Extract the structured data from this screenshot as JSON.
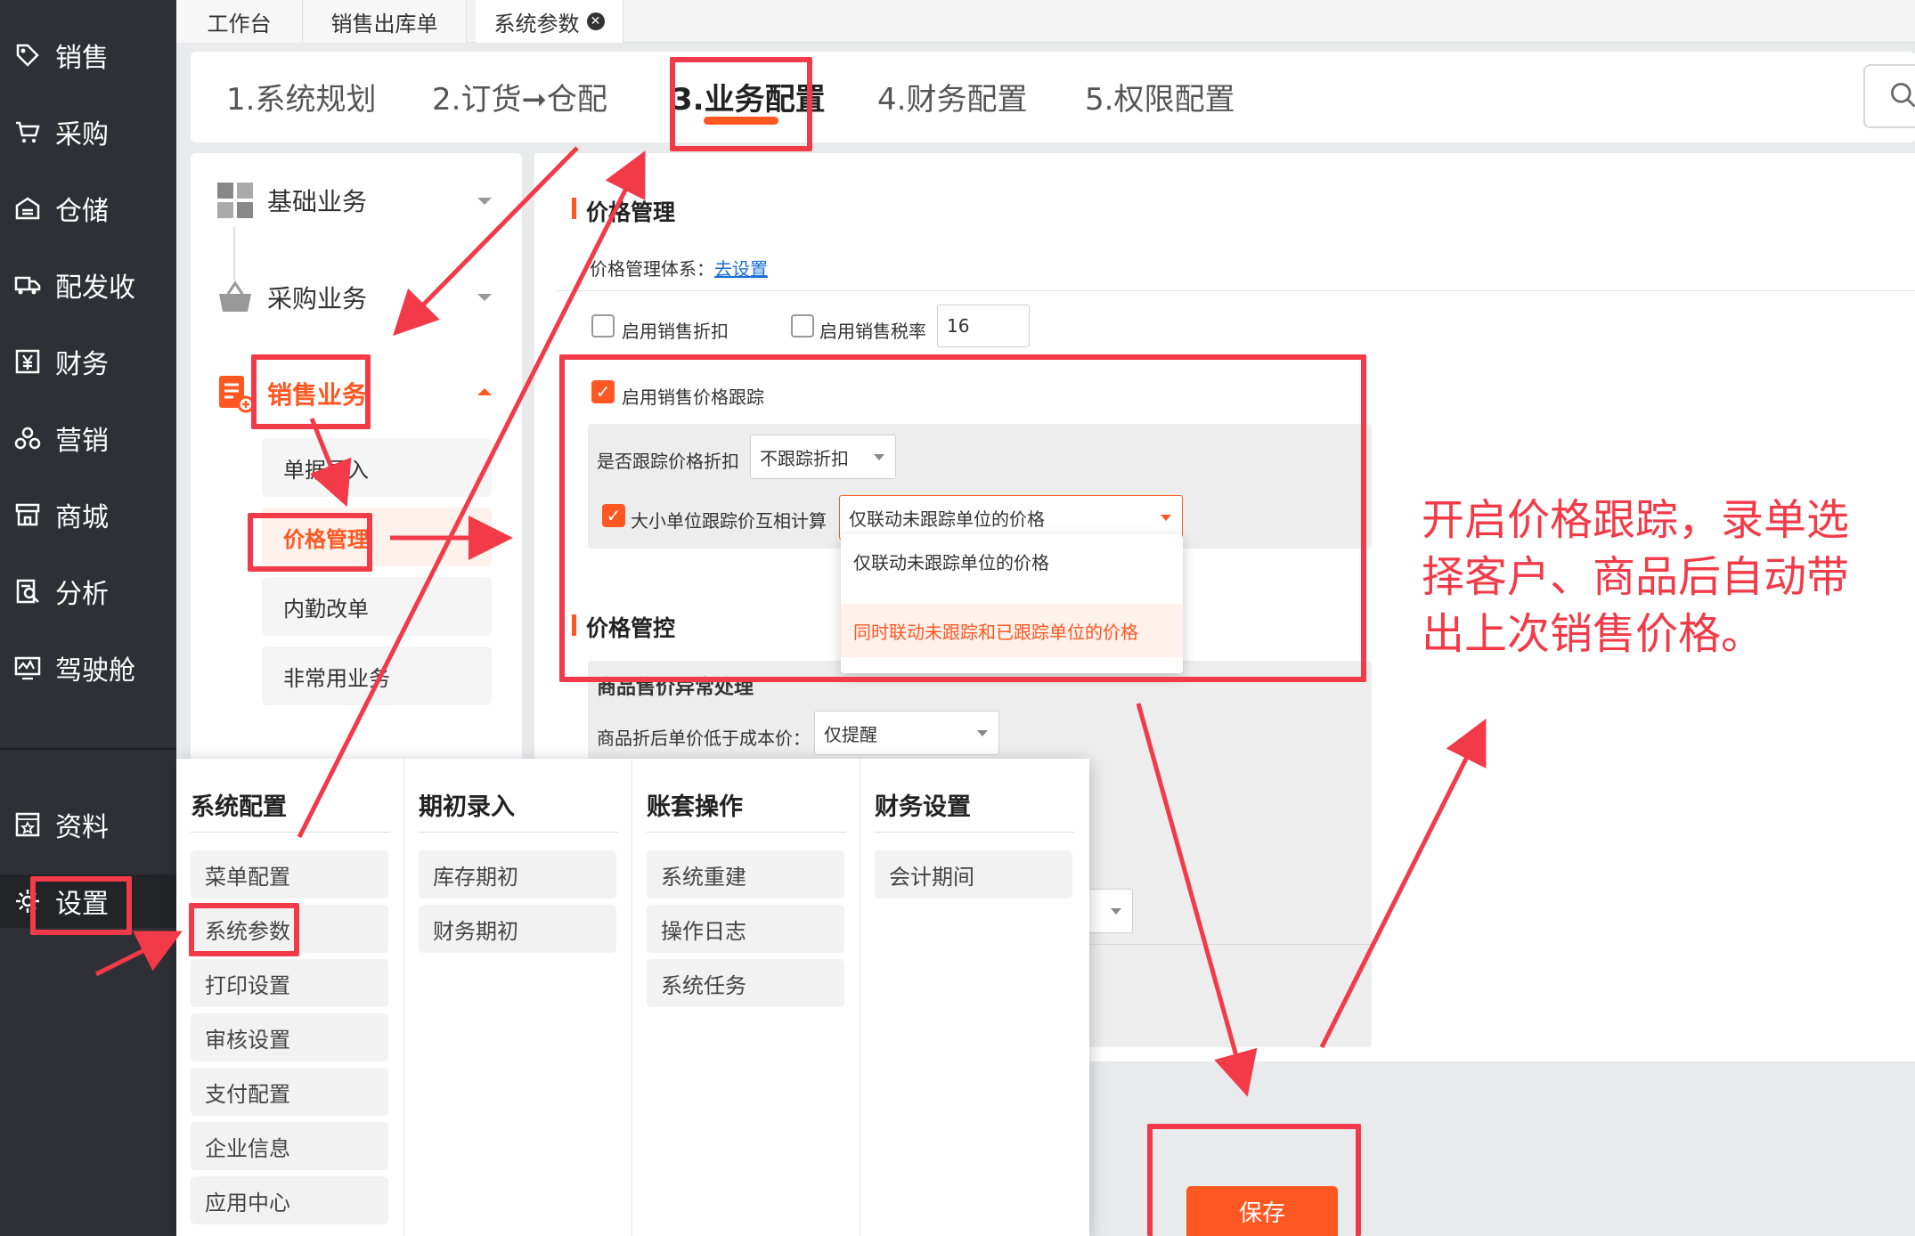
{
  "sidebar": {
    "items": [
      {
        "label": "销售",
        "icon": "tag-icon"
      },
      {
        "label": "采购",
        "icon": "cart-icon"
      },
      {
        "label": "仓储",
        "icon": "warehouse-icon"
      },
      {
        "label": "配发收",
        "icon": "truck-icon"
      },
      {
        "label": "财务",
        "icon": "yen-icon"
      },
      {
        "label": "营销",
        "icon": "marketing-icon"
      },
      {
        "label": "商城",
        "icon": "store-icon"
      },
      {
        "label": "分析",
        "icon": "analysis-icon"
      },
      {
        "label": "驾驶舱",
        "icon": "dashboard-icon"
      },
      {
        "label": "资料",
        "icon": "data-icon"
      },
      {
        "label": "设置",
        "icon": "gear-icon"
      }
    ]
  },
  "tabs": [
    {
      "label": "工作台"
    },
    {
      "label": "销售出库单"
    },
    {
      "label": "系统参数",
      "close": "✕"
    }
  ],
  "steps": [
    {
      "label": "1.系统规划"
    },
    {
      "label": "2.订货➞仓配"
    },
    {
      "label": "3.业务配置"
    },
    {
      "label": "4.财务配置"
    },
    {
      "label": "5.权限配置"
    }
  ],
  "submenu": {
    "groups": [
      {
        "label": "基础业务"
      },
      {
        "label": "采购业务"
      },
      {
        "label": "销售业务"
      }
    ],
    "sales_items": [
      {
        "label": "单据录入"
      },
      {
        "label": "价格管理"
      },
      {
        "label": "内勤改单"
      },
      {
        "label": "非常用业务"
      }
    ]
  },
  "price_mgmt": {
    "title": "价格管理",
    "system_label": "价格管理体系：",
    "system_link": "去设置",
    "sales_discount_label": "启用销售折扣",
    "sales_tax_label": "启用销售税率",
    "sales_tax_value": "16",
    "tracking_label": "启用销售价格跟踪",
    "track_discount_label": "是否跟踪价格折扣",
    "track_discount_value": "不跟踪折扣",
    "unit_calc_label": "大小单位跟踪价互相计算",
    "unit_calc_value": "仅联动未跟踪单位的价格",
    "unit_calc_options": [
      "仅联动未跟踪单位的价格",
      "同时联动未跟踪和已跟踪单位的价格"
    ]
  },
  "price_control": {
    "title": "价格管控",
    "abnormal_title": "商品售价异常处理",
    "below_cost_label": "商品折后单价低于成本价：",
    "below_cost_value": "仅提醒"
  },
  "flyout": {
    "columns": [
      {
        "title": "系统配置",
        "items": [
          "菜单配置",
          "系统参数",
          "打印设置",
          "审核设置",
          "支付配置",
          "企业信息",
          "应用中心"
        ]
      },
      {
        "title": "期初录入",
        "items": [
          "库存期初",
          "财务期初"
        ]
      },
      {
        "title": "账套操作",
        "items": [
          "系统重建",
          "操作日志",
          "系统任务"
        ]
      },
      {
        "title": "财务设置",
        "items": [
          "会计期间"
        ]
      }
    ]
  },
  "save_label": "保存",
  "annotation_note": "开启价格跟踪，录单选择客户、商品后自动带出上次销售价格。",
  "colors": {
    "accent": "#ff5722",
    "sidebar_bg": "#2e3035",
    "annotation_red": "#f23a48"
  }
}
